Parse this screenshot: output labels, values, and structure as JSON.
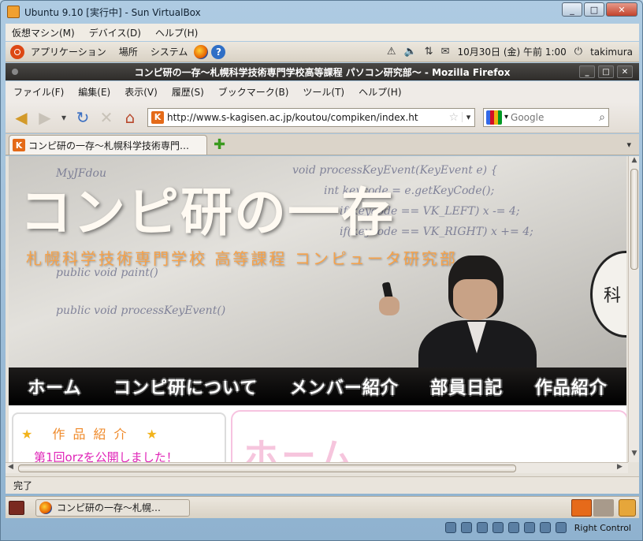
{
  "vbox": {
    "title": "Ubuntu 9.10 [実行中] - Sun VirtualBox",
    "menu": [
      "仮想マシン(M)",
      "デバイス(D)",
      "ヘルプ(H)"
    ],
    "host_key": "Right Control"
  },
  "ubuntu_panel": {
    "menus": [
      "アプリケーション",
      "場所",
      "システム"
    ],
    "clock": "10月30日 (金) 午前 1:00",
    "user": "takimura"
  },
  "firefox": {
    "title": "コンピ研の一存～札幌科学技術専門学校高等課程 パソコン研究部～ - Mozilla Firefox",
    "menu": [
      "ファイル(F)",
      "編集(E)",
      "表示(V)",
      "履歴(S)",
      "ブックマーク(B)",
      "ツール(T)",
      "ヘルプ(H)"
    ],
    "url": "http://www.s-kagisen.ac.jp/koutou/compiken/index.ht",
    "search_placeholder": "Google",
    "tab_label": "コンピ研の一存～札幌科学技術専門…",
    "status": "完了"
  },
  "page": {
    "site_title": "コンピ研の一存",
    "site_subtitle": "札幌科学技術専門学校 高等課程 コンピュータ研究部",
    "nav": [
      "ホーム",
      "コンピ研について",
      "メンバー紹介",
      "部員日記",
      "作品紹介"
    ],
    "side_box_title": "作品紹介",
    "side_box_news": "第1回orzを公開しました！",
    "main_heading": "ホーム",
    "seal_text": "科"
  },
  "taskbar": {
    "task_label": "コンピ研の一存～札幌…"
  }
}
